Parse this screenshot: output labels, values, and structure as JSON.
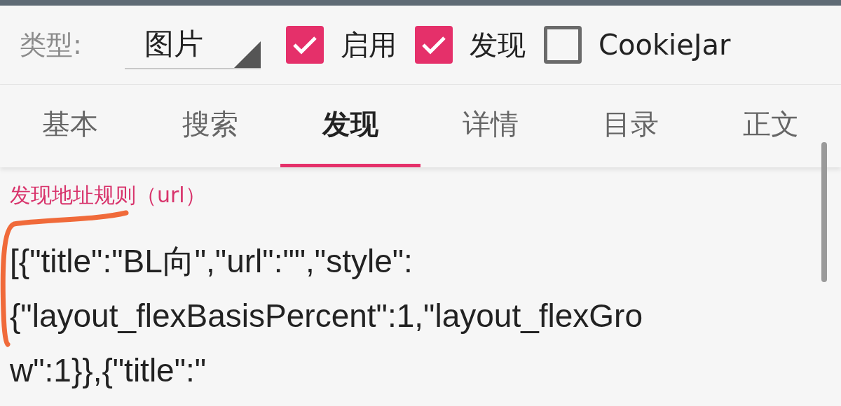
{
  "type_row": {
    "label": "类型:",
    "dropdown": {
      "value": "图片"
    },
    "checkboxes": [
      {
        "label": "启用",
        "checked": true
      },
      {
        "label": "发现",
        "checked": true
      },
      {
        "label": "CookieJar",
        "checked": false
      }
    ]
  },
  "tabs": [
    {
      "label": "基本",
      "selected": false
    },
    {
      "label": "搜索",
      "selected": false
    },
    {
      "label": "发现",
      "selected": true
    },
    {
      "label": "详情",
      "selected": false
    },
    {
      "label": "目录",
      "selected": false
    },
    {
      "label": "正文",
      "selected": false
    }
  ],
  "field": {
    "label": "发现地址规则（url）",
    "value_lines": [
      "[{\"title\":\"BL向\",\"url\":\"\",\"style\":",
      "{\"layout_flexBasisPercent\":1,\"layout_flexGro",
      "w\":1}},{\"title\":\""
    ]
  }
}
